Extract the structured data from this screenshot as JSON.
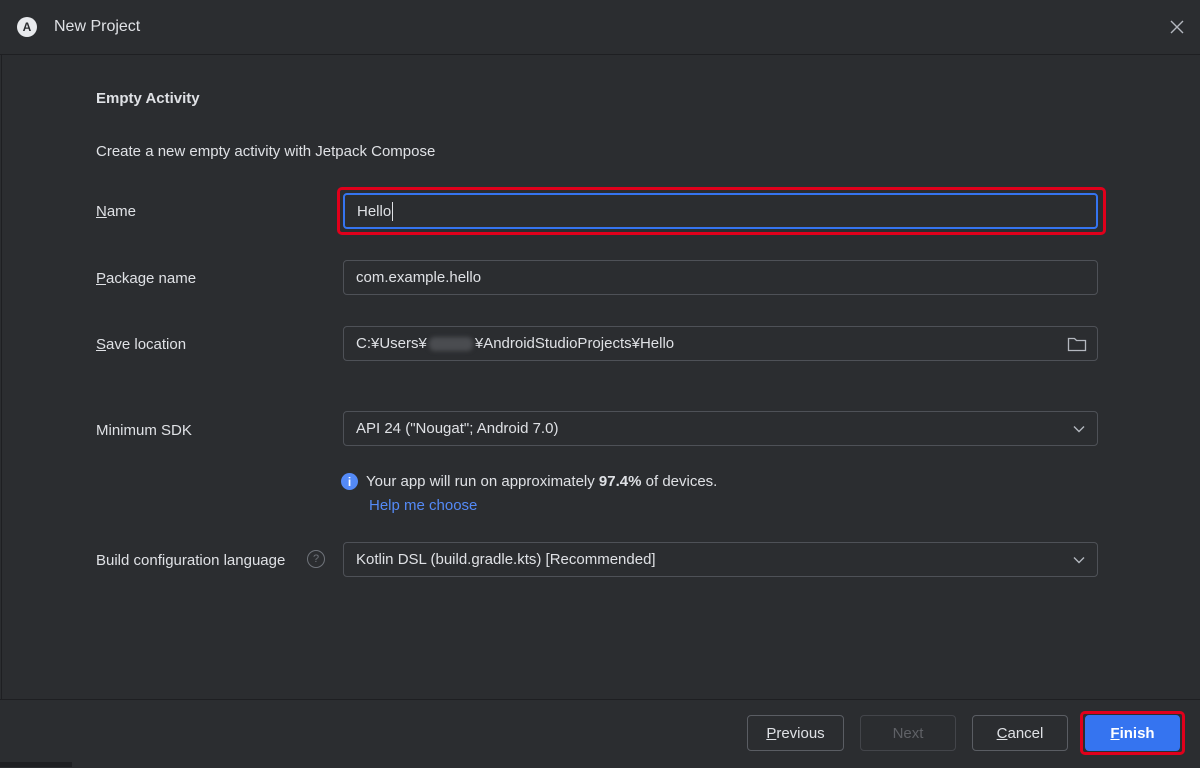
{
  "window": {
    "title": "New Project",
    "app_icon_letter": "A"
  },
  "form": {
    "heading": "Empty Activity",
    "description": "Create a new empty activity with Jetpack Compose",
    "name": {
      "label_first": "N",
      "label_rest": "ame",
      "value": "Hello"
    },
    "package_name": {
      "label_first": "P",
      "label_rest": "ackage name",
      "value": "com.example.hello"
    },
    "save_location": {
      "label_first": "S",
      "label_rest": "ave location",
      "value_prefix": "C:¥Users¥",
      "value_suffix": "¥AndroidStudioProjects¥Hello"
    },
    "minimum_sdk": {
      "label": "Minimum SDK",
      "value": "API 24 (\"Nougat\"; Android 7.0)"
    },
    "sdk_info": {
      "prefix": "Your app will run on approximately ",
      "percent": "97.4%",
      "suffix": " of devices.",
      "help_link": "Help me choose"
    },
    "build_language": {
      "label": "Build configuration language",
      "value": "Kotlin DSL (build.gradle.kts) [Recommended]",
      "help_glyph": "?"
    }
  },
  "footer": {
    "previous": {
      "first": "P",
      "rest": "revious"
    },
    "next": "Next",
    "cancel": {
      "first": "C",
      "rest": "ancel"
    },
    "finish": {
      "first": "F",
      "rest": "inish"
    }
  },
  "colors": {
    "accent": "#3574f0",
    "link": "#548af7",
    "highlight": "#e0001b",
    "background": "#2b2d30"
  }
}
